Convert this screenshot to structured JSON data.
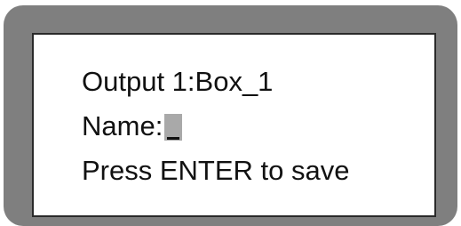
{
  "display": {
    "line1": "Output 1:Box_1",
    "name_label": "Name:",
    "name_value": "_",
    "line3": "Press ENTER to save"
  },
  "colors": {
    "bezel": "#7f7f7f",
    "screen": "#ffffff",
    "text": "#111111",
    "cursor_highlight": "#a9a9a9"
  }
}
